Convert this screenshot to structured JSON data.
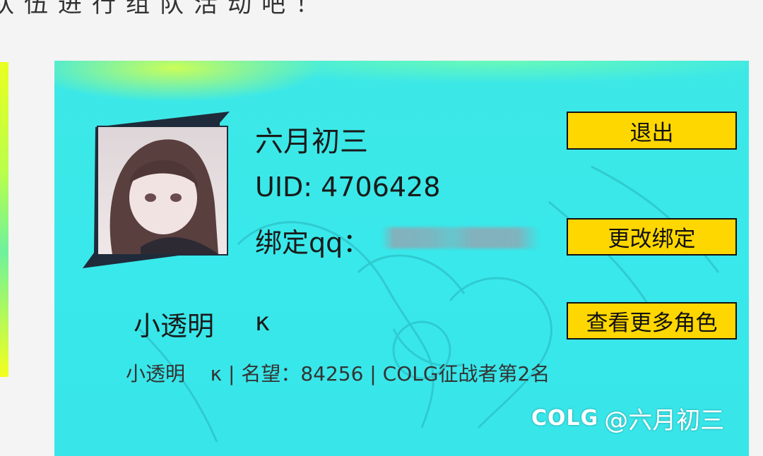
{
  "header": {
    "partial_text": "队伍进行组队活动吧！"
  },
  "profile": {
    "name": "六月初三",
    "uid_text": "UID: 4706428",
    "bind_label": "绑定qq："
  },
  "buttons": {
    "logout": "退出",
    "change_bind": "更改绑定",
    "more_roles": "查看更多角色"
  },
  "character": {
    "name": "小透明",
    "suffix": "κ",
    "info_line": "小透明    κ | 名望：84256 | COLG征战者第2名"
  },
  "watermark": {
    "logo": "COLG",
    "handle": "@六月初三"
  },
  "colors": {
    "card_bg": "#39e8ea",
    "button_bg": "#ffd700",
    "button_border": "#111111"
  }
}
